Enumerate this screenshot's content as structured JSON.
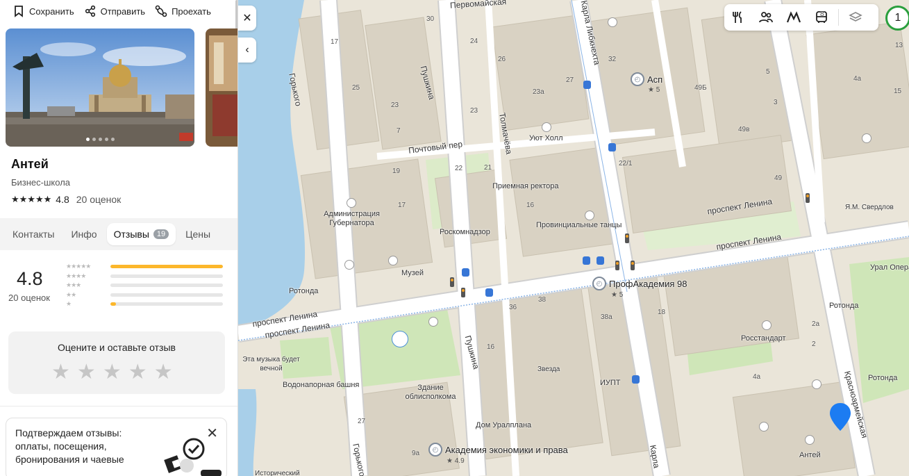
{
  "actions": {
    "save": "Сохранить",
    "share": "Отправить",
    "route": "Проехать"
  },
  "org": {
    "title": "Антей",
    "category": "Бизнес-школа",
    "rating": "4.8",
    "rating_count": "20 оценок"
  },
  "tabs": [
    {
      "label": "Контакты"
    },
    {
      "label": "Инфо"
    },
    {
      "label": "Отзывы",
      "badge": "19",
      "active": true
    },
    {
      "label": "Цены"
    }
  ],
  "summary": {
    "rating": "4.8",
    "count": "20 оценок",
    "distribution": [
      {
        "stars": 5,
        "fraction": 1.0
      },
      {
        "stars": 4,
        "fraction": 0.0
      },
      {
        "stars": 3,
        "fraction": 0.0
      },
      {
        "stars": 2,
        "fraction": 0.0
      },
      {
        "stars": 1,
        "fraction": 0.05
      }
    ]
  },
  "rate_box": {
    "title": "Оцените и оставьте отзыв"
  },
  "promo": {
    "text": "Подтверждаем отзывы: оплаты, посещения, бронирования и чаевые"
  },
  "colors": {
    "accent": "#fcb72b",
    "pin": "#1c7cf2",
    "zoom_ring": "#2a9f3d",
    "water": "#a8cfe9",
    "park": "#cfe6b8"
  },
  "map": {
    "zoom_badge": "1",
    "streets": [
      "проспект Ленина",
      "проспект Ленина",
      "проспект Ленина",
      "проспект Ленина",
      "Почтовый пер",
      "Пушкина",
      "Пушкина",
      "Толмачёва",
      "Карла Либкнехта",
      "Горького",
      "Горького",
      "Красноармейская",
      "Карла",
      "Первомайская"
    ],
    "pois": [
      {
        "name": "Асп",
        "rating": "★ 5"
      },
      {
        "name": "ПрофАкадемия 98",
        "rating": "★ 5"
      },
      {
        "name": "Академия экономики и права",
        "rating": "★ 4.9"
      }
    ],
    "labels": [
      "Уют Холл",
      "Приемная ректора",
      "Провинциальные танцы",
      "Роскомнадзор",
      "Администрация Губернатора",
      "Музей",
      "Ротонда",
      "Ротонда",
      "Ротонда",
      "Урал Опера Ба",
      "Я.М. Свердлов",
      "Росстандарт",
      "Здание облисполкома",
      "Дом Уралплана",
      "Звезда",
      "ИУПТ",
      "Водонапорная башня",
      "Эта музыка будет вечной",
      "Антей",
      "Исторический"
    ],
    "numbers": [
      "30",
      "17",
      "25",
      "24",
      "26",
      "23а",
      "32",
      "27",
      "49Б",
      "5",
      "23",
      "7",
      "23",
      "3",
      "49в",
      "19",
      "22",
      "21",
      "17",
      "16",
      "22/1",
      "49",
      "4а",
      "36",
      "38",
      "38а",
      "18",
      "16",
      "2а",
      "2",
      "4а",
      "27",
      "9а",
      "8",
      "13",
      "15"
    ]
  }
}
